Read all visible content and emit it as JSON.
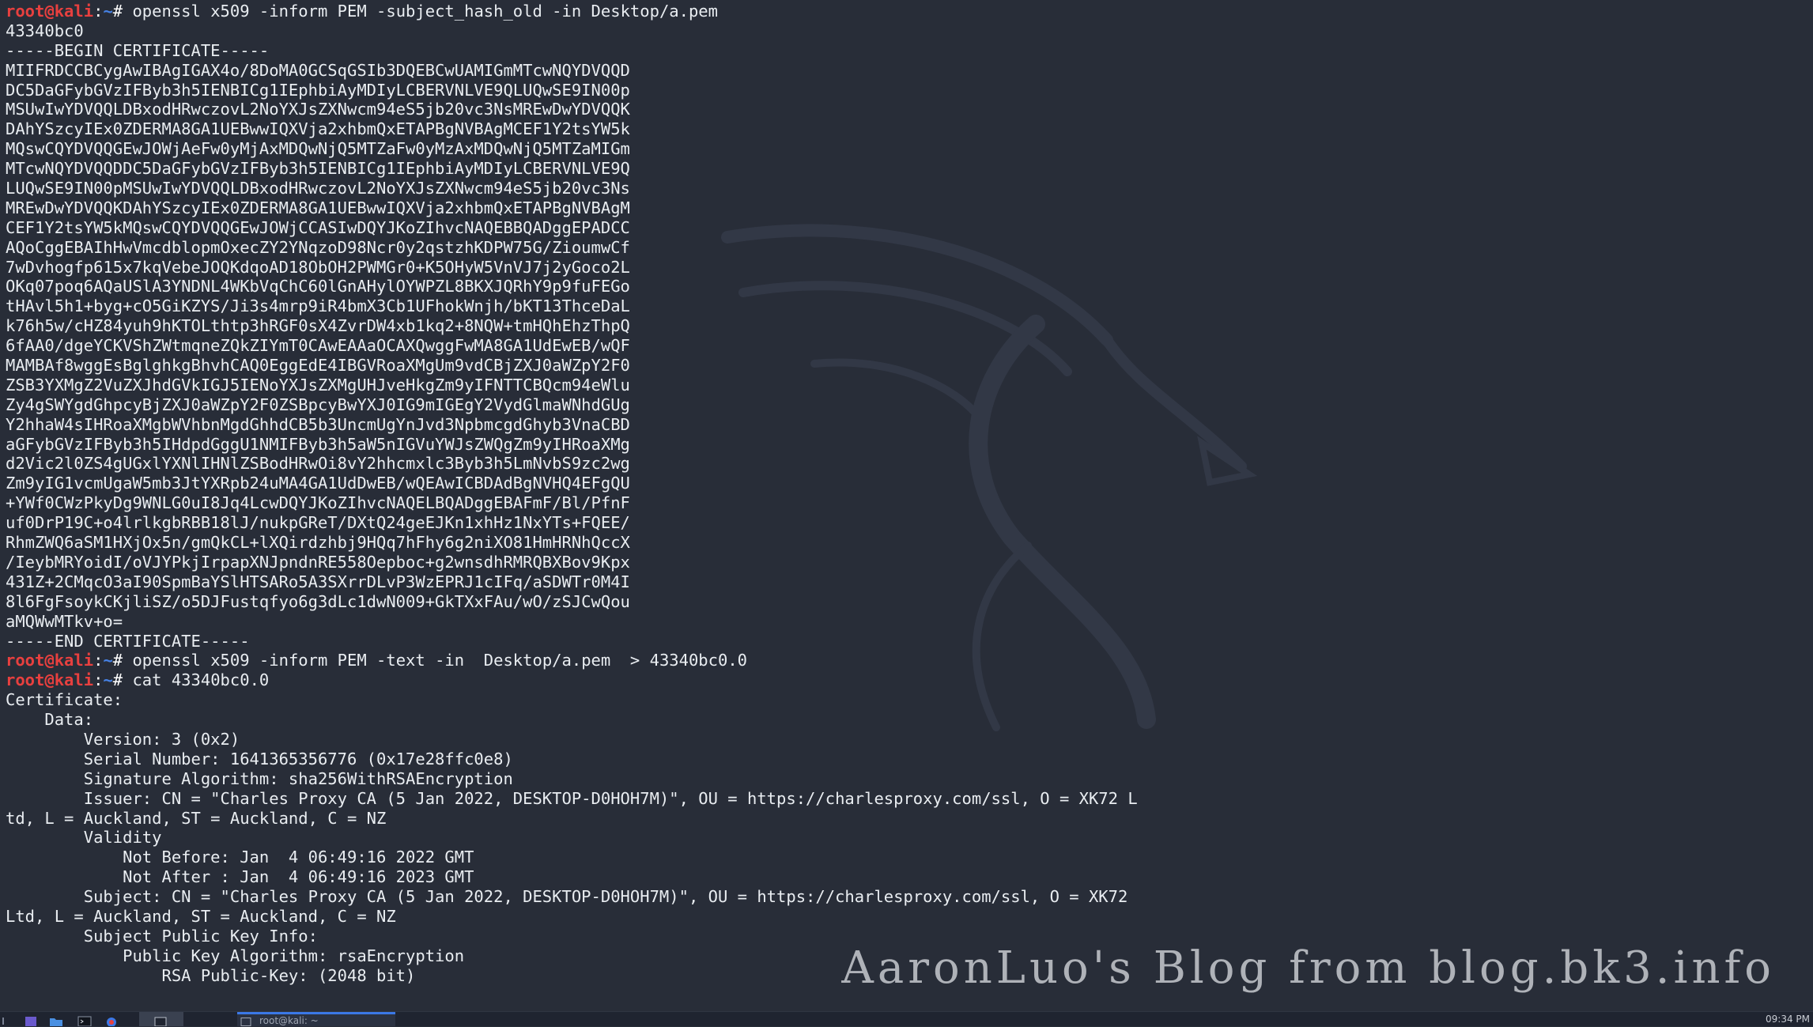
{
  "terminal": {
    "user": "root@kali",
    "path": "~",
    "prompt_symbol": "#",
    "lines": [
      {
        "type": "cmd",
        "text": "openssl x509 -inform PEM -subject_hash_old -in Desktop/a.pem"
      },
      {
        "type": "out",
        "text": "43340bc0"
      },
      {
        "type": "out",
        "text": "-----BEGIN CERTIFICATE-----"
      },
      {
        "type": "out",
        "text": "MIIFRDCCBCygAwIBAgIGAX4o/8DoMA0GCSqGSIb3DQEBCwUAMIGmMTcwNQYDVQQD"
      },
      {
        "type": "out",
        "text": "DC5DaGFybGVzIFByb3h5IENBICg1IEphbiAyMDIyLCBERVNLVE9QLUQwSE9IN00p"
      },
      {
        "type": "out",
        "text": "MSUwIwYDVQQLDBxodHRwczovL2NoYXJsZXNwcm94eS5jb20vc3NsMREwDwYDVQQK"
      },
      {
        "type": "out",
        "text": "DAhYSzcyIEx0ZDERMA8GA1UEBwwIQXVja2xhbmQxETAPBgNVBAgMCEF1Y2tsYW5k"
      },
      {
        "type": "out",
        "text": "MQswCQYDVQQGEwJOWjAeFw0yMjAxMDQwNjQ5MTZaFw0yMzAxMDQwNjQ5MTZaMIGm"
      },
      {
        "type": "out",
        "text": "MTcwNQYDVQQDDC5DaGFybGVzIFByb3h5IENBICg1IEphbiAyMDIyLCBERVNLVE9Q"
      },
      {
        "type": "out",
        "text": "LUQwSE9IN00pMSUwIwYDVQQLDBxodHRwczovL2NoYXJsZXNwcm94eS5jb20vc3Ns"
      },
      {
        "type": "out",
        "text": "MREwDwYDVQQKDAhYSzcyIEx0ZDERMA8GA1UEBwwIQXVja2xhbmQxETAPBgNVBAgM"
      },
      {
        "type": "out",
        "text": "CEF1Y2tsYW5kMQswCQYDVQQGEwJOWjCCASIwDQYJKoZIhvcNAQEBBQADggEPADCC"
      },
      {
        "type": "out",
        "text": "AQoCggEBAIhHwVmcdblopmOxecZY2YNqzoD98Ncr0y2qstzhKDPW75G/ZioumwCf"
      },
      {
        "type": "out",
        "text": "7wDvhogfp615x7kqVebeJOQKdqoAD18ObOH2PWMGr0+K5OHyW5VnVJ7j2yGoco2L"
      },
      {
        "type": "out",
        "text": "OKq07poq6AQaUSlA3YNDNL4WKbVqChC60lGnAHylOYWPZL8BKXJQRhY9p9fuFEGo"
      },
      {
        "type": "out",
        "text": "tHAvl5h1+byg+cO5GiKZYS/Ji3s4mrp9iR4bmX3Cb1UFhokWnjh/bKT13ThceDaL"
      },
      {
        "type": "out",
        "text": "k76h5w/cHZ84yuh9hKTOLthtp3hRGF0sX4ZvrDW4xb1kq2+8NQW+tmHQhEhzThpQ"
      },
      {
        "type": "out",
        "text": "6fAA0/dgeYCKVShZWtmqneZQkZIYmT0CAwEAAaOCAXQwggFwMA8GA1UdEwEB/wQF"
      },
      {
        "type": "out",
        "text": "MAMBAf8wggEsBglghkgBhvhCAQ0EggEdE4IBGVRoaXMgUm9vdCBjZXJ0aWZpY2F0"
      },
      {
        "type": "out",
        "text": "ZSB3YXMgZ2VuZXJhdGVkIGJ5IENoYXJsZXMgUHJveHkgZm9yIFNTTCBQcm94eWlu"
      },
      {
        "type": "out",
        "text": "Zy4gSWYgdGhpcyBjZXJ0aWZpY2F0ZSBpcyBwYXJ0IG9mIGEgY2VydGlmaWNhdGUg"
      },
      {
        "type": "out",
        "text": "Y2hhaW4sIHRoaXMgbWVhbnMgdGhhdCB5b3UncmUgYnJvd3NpbmcgdGhyb3VnaCBD"
      },
      {
        "type": "out",
        "text": "aGFybGVzIFByb3h5IHdpdGggU1NMIFByb3h5aW5nIGVuYWJsZWQgZm9yIHRoaXMg"
      },
      {
        "type": "out",
        "text": "d2Vic2l0ZS4gUGxlYXNlIHNlZSBodHRwOi8vY2hhcmxlc3Byb3h5LmNvbS9zc2wg"
      },
      {
        "type": "out",
        "text": "Zm9yIG1vcmUgaW5mb3JtYXRpb24uMA4GA1UdDwEB/wQEAwICBDAdBgNVHQ4EFgQU"
      },
      {
        "type": "out",
        "text": "+YWf0CWzPkyDg9WNLG0uI8Jq4LcwDQYJKoZIhvcNAQELBQADggEBAFmF/Bl/PfnF"
      },
      {
        "type": "out",
        "text": "uf0DrP19C+o4lrlkgbRBB18lJ/nukpGReT/DXtQ24geEJKn1xhHz1NxYTs+FQEE/"
      },
      {
        "type": "out",
        "text": "RhmZWQ6aSM1HXjOx5n/gmQkCL+lXQirdzhbj9HQq7hFhy6g2niXO81HmHRNhQccX"
      },
      {
        "type": "out",
        "text": "/IeybMRYoidI/oVJYPkjIrpapXNJpndnRE558Oepboc+g2wnsdhRMRQBXBov9Kpx"
      },
      {
        "type": "out",
        "text": "431Z+2CMqcO3aI90SpmBaYSlHTSARo5A3SXrrDLvP3WzEPRJ1cIFq/aSDWTr0M4I"
      },
      {
        "type": "out",
        "text": "8l6FgFsoykCKjliSZ/o5DJFustqfyo6g3dLc1dwN009+GkTXxFAu/wO/zSJCwQou"
      },
      {
        "type": "out",
        "text": "aMQWwMTkv+o="
      },
      {
        "type": "out",
        "text": "-----END CERTIFICATE-----"
      },
      {
        "type": "cmd",
        "text": "openssl x509 -inform PEM -text -in  Desktop/a.pem  > 43340bc0.0"
      },
      {
        "type": "cmd",
        "text": "cat 43340bc0.0"
      },
      {
        "type": "out",
        "text": "Certificate:"
      },
      {
        "type": "out",
        "text": "    Data:"
      },
      {
        "type": "out",
        "text": "        Version: 3 (0x2)"
      },
      {
        "type": "out",
        "text": "        Serial Number: 1641365356776 (0x17e28ffc0e8)"
      },
      {
        "type": "out",
        "text": "        Signature Algorithm: sha256WithRSAEncryption"
      },
      {
        "type": "out",
        "text": "        Issuer: CN = \"Charles Proxy CA (5 Jan 2022, DESKTOP-D0HOH7M)\", OU = https://charlesproxy.com/ssl, O = XK72 L"
      },
      {
        "type": "out",
        "text": "td, L = Auckland, ST = Auckland, C = NZ"
      },
      {
        "type": "out",
        "text": "        Validity"
      },
      {
        "type": "out",
        "text": "            Not Before: Jan  4 06:49:16 2022 GMT"
      },
      {
        "type": "out",
        "text": "            Not After : Jan  4 06:49:16 2023 GMT"
      },
      {
        "type": "out",
        "text": "        Subject: CN = \"Charles Proxy CA (5 Jan 2022, DESKTOP-D0HOH7M)\", OU = https://charlesproxy.com/ssl, O = XK72"
      },
      {
        "type": "out",
        "text": "Ltd, L = Auckland, ST = Auckland, C = NZ"
      },
      {
        "type": "out",
        "text": "        Subject Public Key Info:"
      },
      {
        "type": "out",
        "text": "            Public Key Algorithm: rsaEncryption"
      },
      {
        "type": "out",
        "text": "                RSA Public-Key: (2048 bit)"
      }
    ]
  },
  "watermark": "AaronLuo's Blog from blog.bk3.info",
  "taskbar": {
    "task_label": "root@kali: ~",
    "clock": "09:34 PM",
    "icons": [
      "grid-icon",
      "workspace-icon",
      "folder-icon",
      "terminal-icon",
      "browser-icon",
      "window-icon"
    ]
  },
  "colors": {
    "background": "#282d38",
    "text": "#e9edf1",
    "prompt_user": "#e8403f",
    "prompt_path": "#4682e6",
    "task_accent": "#3b78e7"
  }
}
